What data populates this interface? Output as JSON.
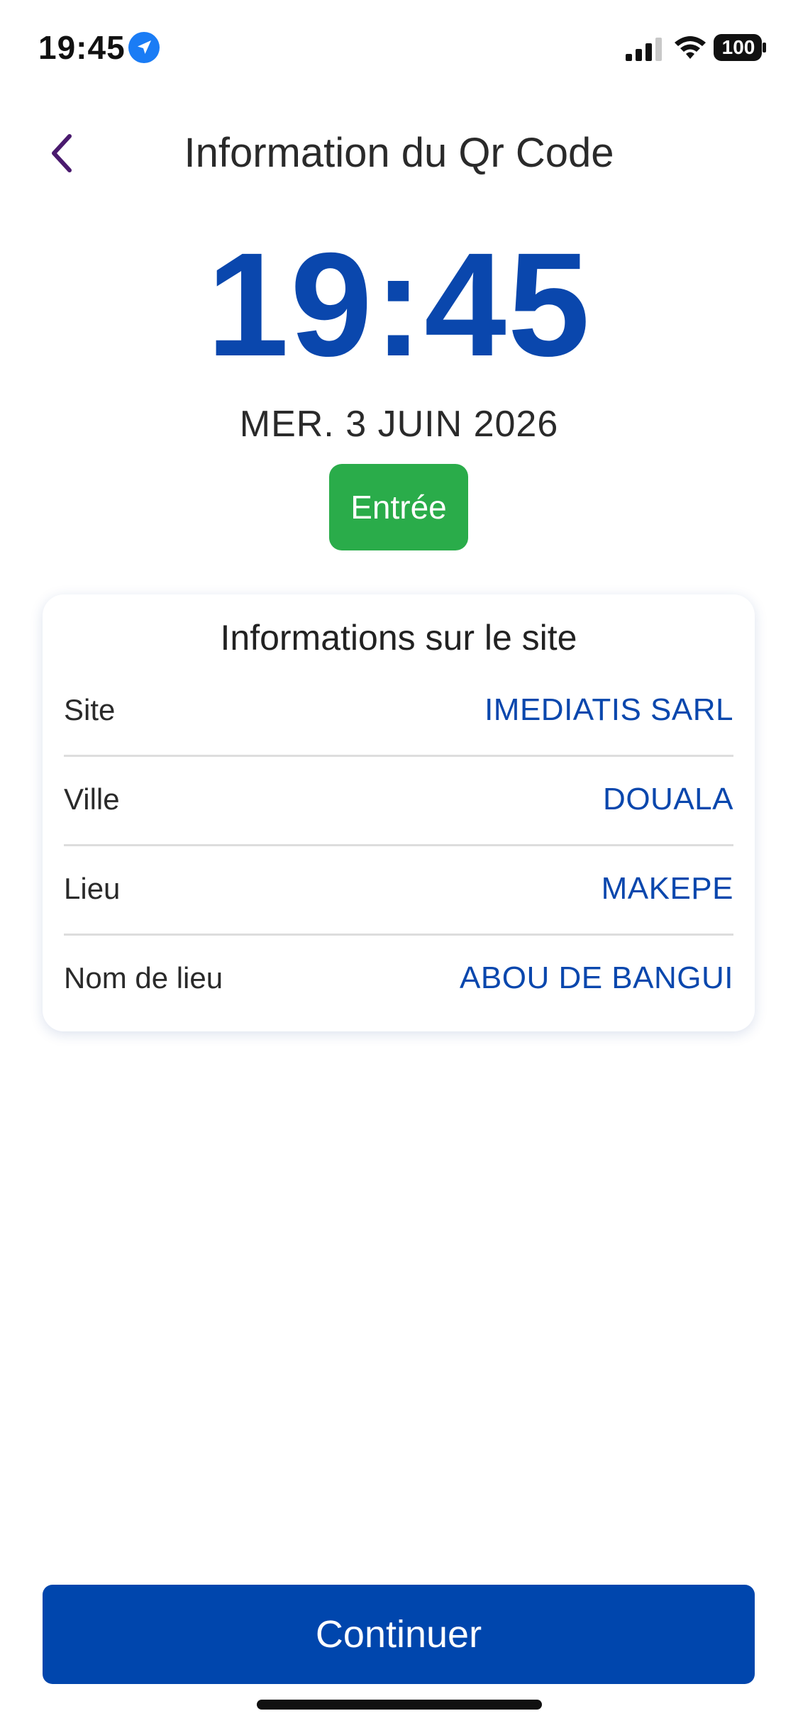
{
  "status_bar": {
    "time": "19:45",
    "battery": "100",
    "location_icon": "location-arrow-icon",
    "signal_icon": "cellular-signal-icon",
    "wifi_icon": "wifi-icon",
    "battery_icon": "battery-icon"
  },
  "header": {
    "title": "Information du Qr Code",
    "back_icon": "chevron-left-icon"
  },
  "clock": {
    "time": "19:45",
    "date": "MER. 3 JUIN 2026"
  },
  "badge": {
    "label": "Entrée",
    "color": "#2aac4a"
  },
  "site_info": {
    "title": "Informations sur le site",
    "rows": [
      {
        "label": "Site",
        "value": "IMEDIATIS SARL"
      },
      {
        "label": "Ville",
        "value": "DOUALA"
      },
      {
        "label": "Lieu",
        "value": "MAKEPE"
      },
      {
        "label": "Nom de lieu",
        "value": "ABOU DE BANGUI"
      }
    ]
  },
  "actions": {
    "continue_label": "Continuer"
  },
  "colors": {
    "accent": "#0a47ad",
    "button": "#0046ad",
    "back_icon": "#4a1a6e"
  }
}
